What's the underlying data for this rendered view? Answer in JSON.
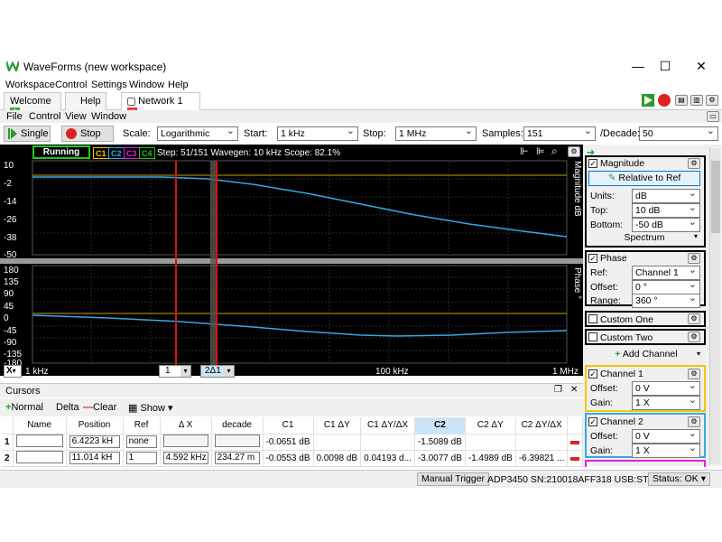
{
  "window": {
    "title": "WaveForms (new workspace)",
    "minimize": "—",
    "maximize": "☐",
    "close": "✕"
  },
  "menu": [
    "Workspace",
    "Control",
    "Settings",
    "Window",
    "Help"
  ],
  "tabs": [
    {
      "label": "Welcome"
    },
    {
      "label": "Help"
    },
    {
      "label": "Network 1",
      "active": true
    }
  ],
  "submenu": [
    "File",
    "Control",
    "View",
    "Window"
  ],
  "toolbar": {
    "single": "Single",
    "stop": "Stop",
    "scale_label": "Scale:",
    "scale_value": "Logarithmic",
    "start_label": "Start:",
    "start_value": "1 kHz",
    "stop_label": "Stop:",
    "stop_value": "1 MHz",
    "samples_label": "Samples:",
    "samples_value": "151",
    "decade_label": "/Decade:",
    "decade_value": "50"
  },
  "plot": {
    "status": "Running",
    "channels": [
      {
        "name": "C1",
        "color": "#f5c400"
      },
      {
        "name": "C2",
        "color": "#36a9e1"
      },
      {
        "name": "C3",
        "color": "#e020e0"
      },
      {
        "name": "C4",
        "color": "#18c818"
      }
    ],
    "step_info": "Step: 51/151   Wavegen: 10 kHz   Scope: 82.1%",
    "mag_ticks": [
      "10",
      "-2",
      "-14",
      "-26",
      "-38",
      "-50"
    ],
    "phase_ticks": [
      "180",
      "135",
      "90",
      "45",
      "0",
      "-45",
      "-90",
      "-135",
      "-180"
    ],
    "mag_axis_label": "Magnitude dB",
    "phase_axis_label": "Phase °",
    "x_axis_x": "X",
    "x_start": "1 kHz",
    "x_mid": "100 kHz",
    "x_end": "1 MHz",
    "cursor_pick": "1",
    "cursor_delta": "2Δ1"
  },
  "cursors": {
    "title": "Cursors",
    "normal": "Normal",
    "delta": "Delta",
    "clear": "Clear",
    "show": "Show",
    "columns": [
      "Name",
      "Position",
      "Ref",
      "Δ X",
      "decade",
      "C1",
      "C1 ΔY",
      "C1 ΔY/ΔX",
      "C2",
      "C2 ΔY",
      "C2 ΔY/ΔX"
    ],
    "rows": [
      {
        "index": "1",
        "name": "",
        "position": "6.4223 kH",
        "ref": "none",
        "dx": "",
        "decade": "",
        "c1": "-0.0651 dB",
        "c1dy": "",
        "c1dydx": "",
        "c2": "-1.5089 dB",
        "c2dy": "",
        "c2dydx": ""
      },
      {
        "index": "2",
        "name": "",
        "position": "11.014 kH",
        "ref": "1",
        "dx": "4.592 kHz",
        "decade": "234.27 m",
        "c1": "-0.0553 dB",
        "c1dy": "0.0098 dB",
        "c1dydx": "0.04193 d...",
        "c2": "-3.0077 dB",
        "c2dy": "-1.4989 dB",
        "c2dydx": "-6.39821 ..."
      }
    ]
  },
  "right": {
    "magnitude": {
      "label": "Magnitude",
      "relative": "Relative to Ref",
      "units_label": "Units:",
      "units": "dB",
      "top_label": "Top:",
      "top": "10 dB",
      "bottom_label": "Bottom:",
      "bottom": "-50 dB",
      "spectrum": "Spectrum"
    },
    "phase": {
      "label": "Phase",
      "ref_label": "Ref:",
      "ref": "Channel 1",
      "offset_label": "Offset:",
      "offset": "0 °",
      "range_label": "Range:",
      "range": "360 °"
    },
    "custom_one": "Custom One",
    "custom_two": "Custom Two",
    "add_channel": "Add Channel",
    "channel1": {
      "label": "Channel 1",
      "offset_label": "Offset:",
      "offset": "0 V",
      "gain_label": "Gain:",
      "gain": "1 X"
    },
    "channel2": {
      "label": "Channel 2",
      "offset_label": "Offset:",
      "offset": "0 V",
      "gain_label": "Gain:",
      "gain": "1 X"
    }
  },
  "status": {
    "trigger": "Manual Trigger",
    "device": "ADP3450 SN:210018AFF318 USB:ST",
    "status": "Status: OK"
  }
}
